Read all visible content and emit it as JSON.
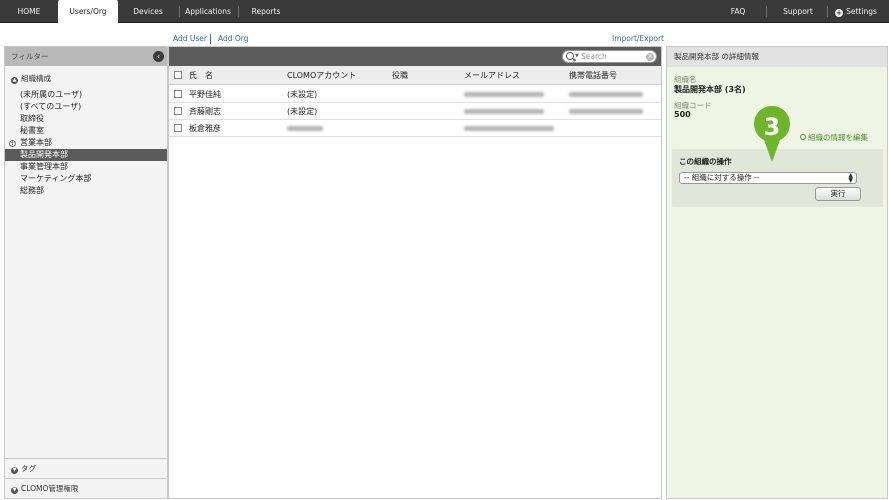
{
  "nav": {
    "tabs": [
      "HOME",
      "Users/Org",
      "Devices",
      "Applications",
      "Reports"
    ],
    "active_tab": "Users/Org",
    "right": [
      "FAQ",
      "Support",
      "Settings"
    ]
  },
  "actions": {
    "add_user": "Add User",
    "add_org": "Add Org",
    "import_export": "Import/Export"
  },
  "sidebar": {
    "filter_title": "フィルター",
    "org_section": "組織構成",
    "items": [
      "(未所属のユーザ)",
      "(すべてのユーザ)",
      "取締役",
      "秘書室",
      "営業本部",
      "製品開発本部",
      "事業管理本部",
      "マーケティング本部",
      "総務部"
    ],
    "selected_item": "製品開発本部",
    "tag_section": "タグ",
    "admin_section": "CLOMO管理権限"
  },
  "list": {
    "search_placeholder": "Search",
    "columns": [
      "氏　名",
      "CLOMOアカウント",
      "役職",
      "メールアドレス",
      "携帯電話番号"
    ],
    "rows": [
      {
        "name": "平野佳純",
        "account": "(未設定)"
      },
      {
        "name": "斉藤剛志",
        "account": "(未設定)"
      },
      {
        "name": "板倉雅彦",
        "account": ""
      }
    ]
  },
  "detail": {
    "header": "製品開発本部 の詳細情報",
    "org_name_label": "組織名",
    "org_name_value": "製品開発本部 (3名)",
    "org_code_label": "組織コード",
    "org_code_value": "500",
    "edit_link": "組織の情報を編集",
    "ops_title": "この組織の操作",
    "ops_select_value": "-- 組織に対する操作 --",
    "exec_button": "実行",
    "callout_number": "3"
  },
  "colors": {
    "nav_bg": "#3a3a3a",
    "link": "#2a6fb5",
    "selected_item": "#5b5b5b",
    "detail_bg": "#eef5e5",
    "callout": "#6fb52c"
  }
}
